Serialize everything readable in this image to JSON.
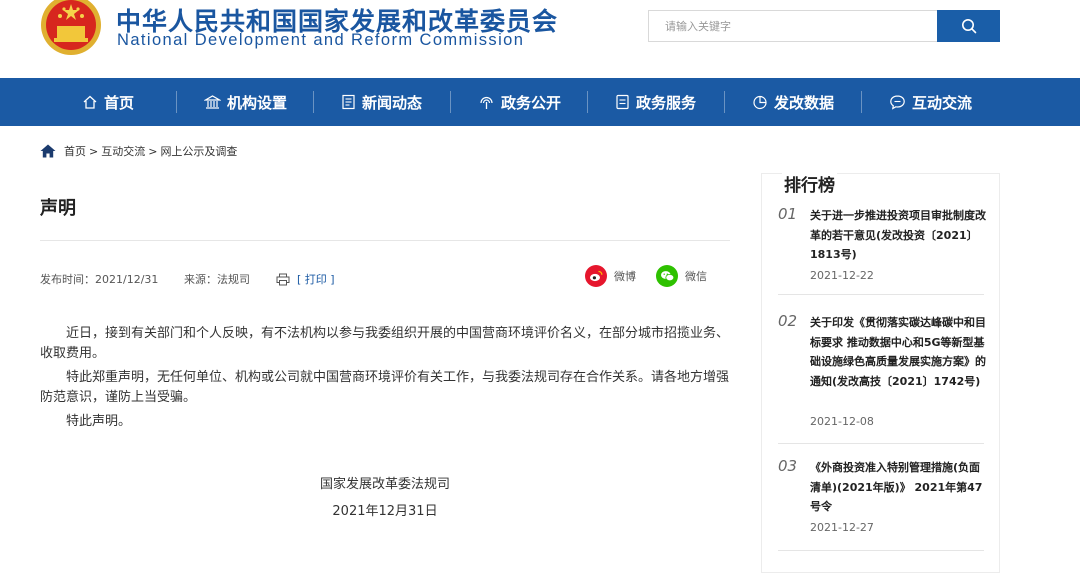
{
  "header": {
    "title_cn": "中华人民共和国国家发展和改革委员会",
    "title_en": "National Development and Reform Commission",
    "search_placeholder": "请输入关键字",
    "emblem_icon": "national-emblem-icon",
    "brand_color": "#1b5aa4",
    "emblem_color": "#d7261e"
  },
  "nav": {
    "items": [
      {
        "label": "首页",
        "icon": "home-icon"
      },
      {
        "label": "机构设置",
        "icon": "building-icon"
      },
      {
        "label": "新闻动态",
        "icon": "news-icon"
      },
      {
        "label": "政务公开",
        "icon": "broadcast-icon"
      },
      {
        "label": "政务服务",
        "icon": "document-icon"
      },
      {
        "label": "发改数据",
        "icon": "pie-chart-icon"
      },
      {
        "label": "互动交流",
        "icon": "chat-icon"
      }
    ]
  },
  "breadcrumb": {
    "items": [
      "首页",
      "互动交流",
      "网上公示及调查"
    ],
    "separator": ">"
  },
  "article": {
    "title": "声明",
    "publish_time": "发布时间：2021/12/31",
    "source": "来源：法规司",
    "print_label": "[ 打印 ]",
    "share_weibo": "微博",
    "share_wechat": "微信",
    "paragraphs": [
      "近日，接到有关部门和个人反映，有不法机构以参与我委组织开展的中国营商环境评价名义，在部分城市招揽业务、收取费用。",
      "特此郑重声明，无任何单位、机构或公司就中国营商环境评价有关工作，与我委法规司存在合作关系。请各地方增强防范意识，谨防上当受骗。",
      "特此声明。"
    ],
    "signature": "国家发展改革委法规司",
    "sign_date": "2021年12月31日"
  },
  "sidebar": {
    "title": "排行榜",
    "items": [
      {
        "num": "01",
        "text": "关于进一步推进投资项目审批制度改革的若干意见(发改投资〔2021〕1813号)",
        "date": "2021-12-22"
      },
      {
        "num": "02",
        "text": "关于印发《贯彻落实碳达峰碳中和目标要求 推动数据中心和5G等新型基础设施绿色高质量发展实施方案》的通知(发改高技〔2021〕1742号)",
        "date": "2021-12-08"
      },
      {
        "num": "03",
        "text": "《外商投资准入特别管理措施(负面清单)(2021年版)》 2021年第47号令",
        "date": "2021-12-27"
      }
    ]
  }
}
